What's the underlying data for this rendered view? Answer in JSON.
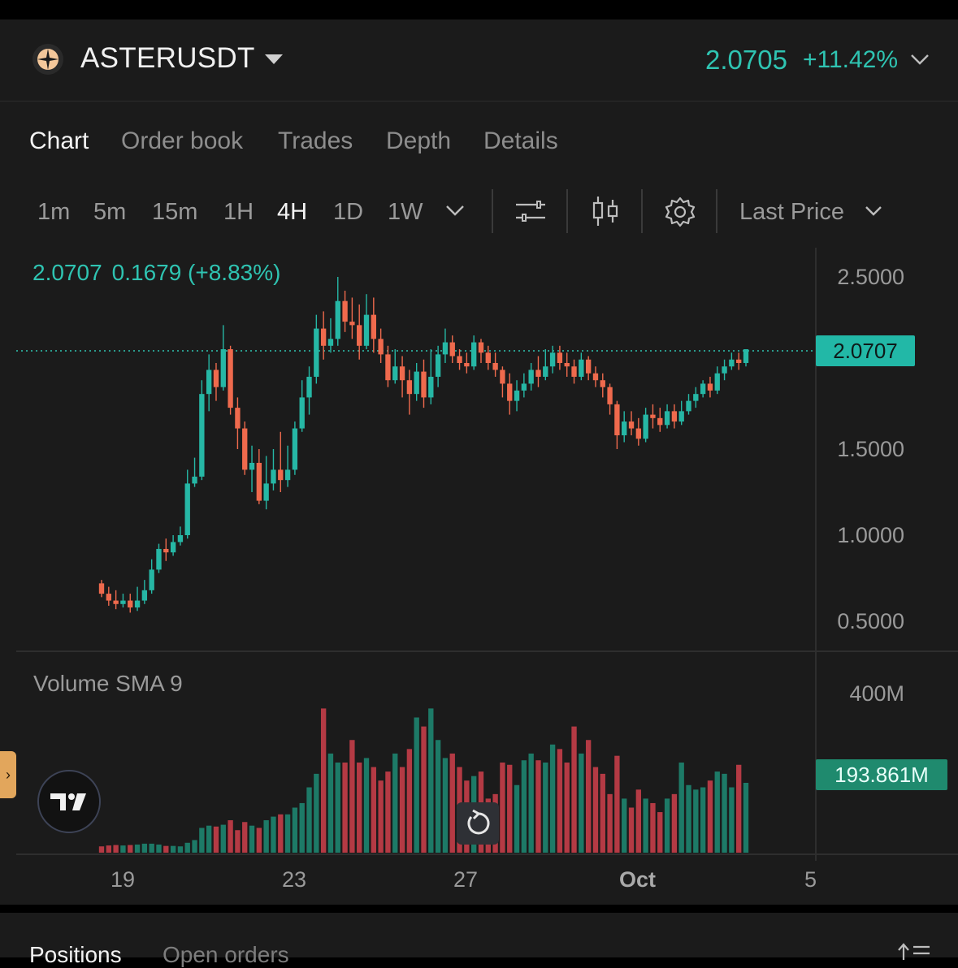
{
  "header": {
    "pair": "ASTERUSDT",
    "price": "2.0705",
    "change": "+11.42%",
    "logo_icon": "aster-logo-icon"
  },
  "tabs": [
    {
      "label": "Chart",
      "active": true
    },
    {
      "label": "Order book",
      "active": false
    },
    {
      "label": "Trades",
      "active": false
    },
    {
      "label": "Depth",
      "active": false
    },
    {
      "label": "Details",
      "active": false
    }
  ],
  "toolbar": {
    "timeframes": [
      "1m",
      "5m",
      "15m",
      "1H",
      "4H",
      "1D",
      "1W"
    ],
    "active_timeframe": "4H",
    "price_source": "Last Price",
    "icons": [
      "chevron-down-icon",
      "indicators-icon",
      "candle-type-icon",
      "gear-icon"
    ]
  },
  "legend": {
    "close": "2.0707",
    "change": "0.1679 (+8.83%)"
  },
  "chart_axis": {
    "price_ticks": [
      "2.5000",
      "1.5000",
      "1.0000",
      "0.5000"
    ],
    "price_tag": "2.0707",
    "volume_label": "Volume SMA 9",
    "volume_tick": "400M",
    "volume_tag": "193.861M",
    "x_ticks": [
      "19",
      "23",
      "27",
      "Oct",
      "5"
    ]
  },
  "chart_data": {
    "type": "candlestick",
    "price_range": [
      0.5,
      2.5
    ],
    "last_price": 2.0707,
    "volume_max_m": 400,
    "colors": {
      "up": "#26b7a5",
      "down": "#ef6a4d",
      "vol_up": "#1d7a67",
      "vol_down": "#b43a44"
    },
    "candles": [
      [
        0.72,
        0.66,
        0.74,
        0.64,
        14
      ],
      [
        0.66,
        0.62,
        0.7,
        0.59,
        16
      ],
      [
        0.62,
        0.6,
        0.68,
        0.57,
        17
      ],
      [
        0.6,
        0.62,
        0.66,
        0.58,
        16
      ],
      [
        0.62,
        0.58,
        0.66,
        0.55,
        17
      ],
      [
        0.58,
        0.62,
        0.7,
        0.56,
        18
      ],
      [
        0.62,
        0.68,
        0.74,
        0.6,
        20
      ],
      [
        0.68,
        0.8,
        0.86,
        0.66,
        20
      ],
      [
        0.8,
        0.92,
        0.95,
        0.78,
        18
      ],
      [
        0.92,
        0.9,
        0.98,
        0.85,
        15
      ],
      [
        0.9,
        0.96,
        1.0,
        0.88,
        15
      ],
      [
        0.96,
        1.0,
        1.05,
        0.94,
        14
      ],
      [
        1.0,
        1.3,
        1.38,
        0.98,
        22
      ],
      [
        1.3,
        1.34,
        1.45,
        1.28,
        28
      ],
      [
        1.34,
        1.82,
        1.9,
        1.32,
        55
      ],
      [
        1.82,
        1.96,
        2.05,
        1.72,
        60
      ],
      [
        1.96,
        1.86,
        2.0,
        1.78,
        58
      ],
      [
        1.86,
        2.08,
        2.22,
        1.84,
        62
      ],
      [
        2.08,
        1.74,
        2.1,
        1.7,
        72
      ],
      [
        1.74,
        1.62,
        1.8,
        1.5,
        50
      ],
      [
        1.62,
        1.38,
        1.66,
        1.35,
        68
      ],
      [
        1.38,
        1.42,
        1.52,
        1.25,
        60
      ],
      [
        1.42,
        1.2,
        1.5,
        1.18,
        55
      ],
      [
        1.2,
        1.3,
        1.46,
        1.15,
        72
      ],
      [
        1.3,
        1.38,
        1.5,
        1.26,
        80
      ],
      [
        1.38,
        1.32,
        1.6,
        1.25,
        85
      ],
      [
        1.32,
        1.38,
        1.52,
        1.28,
        85
      ],
      [
        1.38,
        1.62,
        1.66,
        1.35,
        100
      ],
      [
        1.62,
        1.8,
        1.9,
        1.6,
        110
      ],
      [
        1.8,
        1.92,
        1.98,
        1.7,
        145
      ],
      [
        1.92,
        2.2,
        2.28,
        1.88,
        175
      ],
      [
        2.2,
        2.1,
        2.3,
        2.02,
        320
      ],
      [
        2.1,
        2.14,
        2.26,
        2.06,
        220
      ],
      [
        2.14,
        2.36,
        2.5,
        2.1,
        200
      ],
      [
        2.36,
        2.24,
        2.42,
        2.18,
        200
      ],
      [
        2.24,
        2.22,
        2.38,
        2.14,
        250
      ],
      [
        2.22,
        2.1,
        2.34,
        2.02,
        200
      ],
      [
        2.1,
        2.28,
        2.4,
        2.08,
        210
      ],
      [
        2.28,
        2.14,
        2.38,
        2.06,
        190
      ],
      [
        2.14,
        2.05,
        2.2,
        2.0,
        160
      ],
      [
        2.05,
        1.9,
        2.1,
        1.86,
        180
      ],
      [
        1.9,
        1.98,
        2.08,
        1.88,
        220
      ],
      [
        1.98,
        1.9,
        2.04,
        1.8,
        190
      ],
      [
        1.9,
        1.82,
        1.96,
        1.7,
        230
      ],
      [
        1.82,
        1.95,
        2.0,
        1.78,
        300
      ],
      [
        1.95,
        1.8,
        2.02,
        1.74,
        280
      ],
      [
        1.8,
        1.92,
        2.08,
        1.76,
        320
      ],
      [
        1.92,
        2.05,
        2.1,
        1.86,
        250
      ],
      [
        2.05,
        2.12,
        2.2,
        2.0,
        210
      ],
      [
        2.12,
        2.04,
        2.16,
        2.0,
        220
      ],
      [
        2.04,
        2.0,
        2.08,
        1.96,
        190
      ],
      [
        2.0,
        1.98,
        2.06,
        1.94,
        160
      ],
      [
        1.98,
        2.12,
        2.16,
        1.96,
        170
      ],
      [
        2.12,
        2.06,
        2.14,
        2.0,
        180
      ],
      [
        2.06,
        2.0,
        2.1,
        1.96,
        120
      ],
      [
        2.0,
        1.96,
        2.06,
        1.92,
        130
      ],
      [
        1.96,
        1.88,
        1.98,
        1.8,
        200
      ],
      [
        1.88,
        1.78,
        1.94,
        1.7,
        195
      ],
      [
        1.78,
        1.84,
        1.9,
        1.72,
        150
      ],
      [
        1.84,
        1.88,
        1.94,
        1.8,
        205
      ],
      [
        1.88,
        1.96,
        2.0,
        1.84,
        220
      ],
      [
        1.96,
        1.92,
        2.04,
        1.86,
        205
      ],
      [
        1.92,
        1.98,
        2.08,
        1.9,
        200
      ],
      [
        1.98,
        2.06,
        2.1,
        1.94,
        240
      ],
      [
        2.06,
        2.0,
        2.1,
        1.96,
        230
      ],
      [
        2.0,
        1.98,
        2.06,
        1.92,
        200
      ],
      [
        1.98,
        1.92,
        2.02,
        1.88,
        280
      ],
      [
        1.92,
        2.02,
        2.06,
        1.9,
        220
      ],
      [
        2.02,
        1.94,
        2.04,
        1.9,
        250
      ],
      [
        1.94,
        1.9,
        1.98,
        1.86,
        190
      ],
      [
        1.9,
        1.86,
        1.94,
        1.8,
        175
      ],
      [
        1.86,
        1.76,
        1.88,
        1.7,
        130
      ],
      [
        1.76,
        1.58,
        1.78,
        1.5,
        215
      ],
      [
        1.58,
        1.66,
        1.72,
        1.54,
        120
      ],
      [
        1.66,
        1.62,
        1.72,
        1.58,
        100
      ],
      [
        1.62,
        1.56,
        1.68,
        1.52,
        140
      ],
      [
        1.56,
        1.7,
        1.74,
        1.54,
        120
      ],
      [
        1.7,
        1.68,
        1.76,
        1.62,
        110
      ],
      [
        1.68,
        1.64,
        1.74,
        1.6,
        90
      ],
      [
        1.64,
        1.72,
        1.76,
        1.62,
        120
      ],
      [
        1.72,
        1.66,
        1.76,
        1.62,
        130
      ],
      [
        1.66,
        1.72,
        1.78,
        1.64,
        200
      ],
      [
        1.72,
        1.78,
        1.82,
        1.7,
        150
      ],
      [
        1.78,
        1.82,
        1.86,
        1.74,
        140
      ],
      [
        1.82,
        1.88,
        1.9,
        1.8,
        145
      ],
      [
        1.88,
        1.84,
        1.92,
        1.8,
        160
      ],
      [
        1.84,
        1.94,
        1.98,
        1.82,
        180
      ],
      [
        1.94,
        1.98,
        2.02,
        1.9,
        175
      ],
      [
        1.98,
        2.02,
        2.06,
        1.96,
        145
      ],
      [
        2.02,
        2.0,
        2.06,
        1.96,
        195
      ],
      [
        2.0,
        2.08,
        2.08,
        1.98,
        155
      ]
    ]
  }
}
